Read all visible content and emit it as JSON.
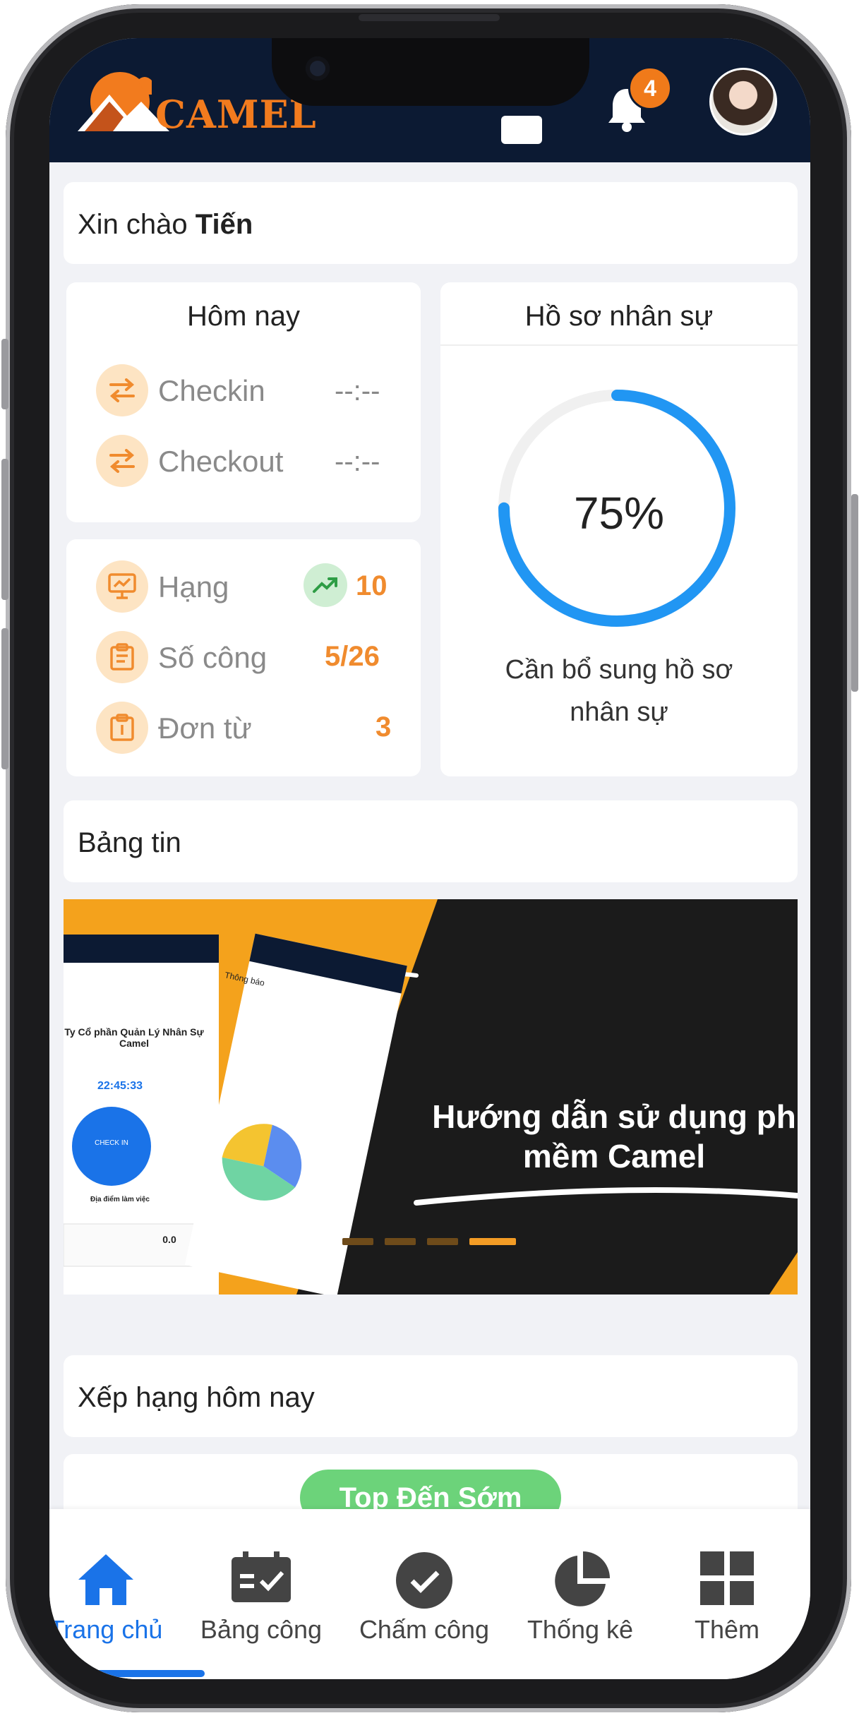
{
  "header": {
    "logo_text": "CAMEL",
    "notification_count": "4"
  },
  "greeting": {
    "prefix": "Xin chào",
    "name": "Tiến"
  },
  "today": {
    "title": "Hôm nay",
    "checkin_label": "Checkin",
    "checkin_value": "--:--",
    "checkout_label": "Checkout",
    "checkout_value": "--:--"
  },
  "stats": {
    "rank_label": "Hạng",
    "rank_value": "10",
    "workdays_label": "Số công",
    "workdays_value": "5/26",
    "requests_label": "Đơn từ",
    "requests_value": "3"
  },
  "profile": {
    "title": "Hồ sơ nhân sự",
    "percent_text": "75%",
    "percent": 75,
    "note_line1": "Cần bổ sung hồ sơ",
    "note_line2": "nhân sự"
  },
  "news": {
    "title": "Bảng tin",
    "banner_line1": "Hướng dẫn sử dụng ph",
    "banner_line2": "mềm Camel",
    "banner_app_company": "Ty Cổ phần Quản Lý Nhân Sự Camel",
    "banner_app_time": "22:45:33",
    "banner_app_checkin": "CHECK IN",
    "banner_app_location": "Địa điểm làm việc",
    "banner_app_stat": "0.0",
    "banner_app_notice": "Thông báo"
  },
  "ranking": {
    "title": "Xếp hạng hôm nay",
    "button_label": "Top Đến Sớm"
  },
  "bottom_nav": {
    "home": "Trang chủ",
    "timesheet": "Bảng công",
    "attendance": "Chấm công",
    "statistics": "Thống kê",
    "more": "Thêm"
  },
  "colors": {
    "header_bg": "#0c1a33",
    "accent_orange": "#f08b2e",
    "primary_blue": "#1a73e8",
    "progress_blue": "#2196f3",
    "rank_green": "#6cd37a"
  }
}
